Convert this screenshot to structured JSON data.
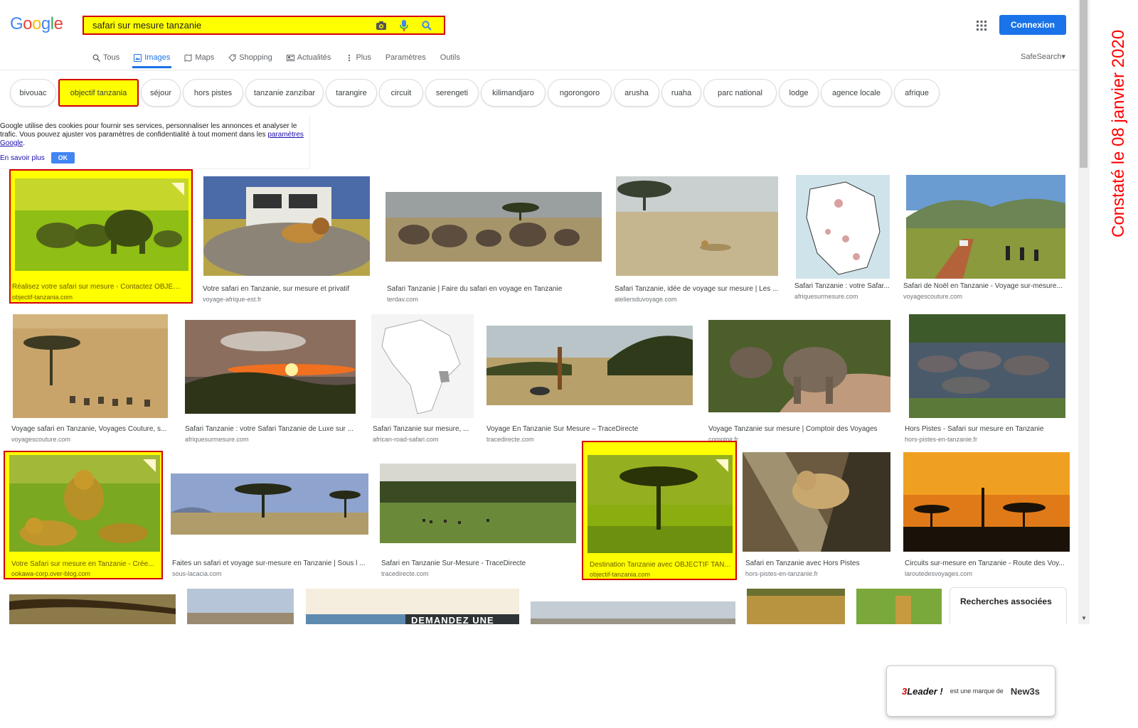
{
  "header": {
    "logo_text": "Google",
    "search_value": "safari sur mesure tanzanie",
    "signin_label": "Connexion",
    "safesearch_label": "SafeSearch▾"
  },
  "tabs": [
    {
      "label": "Tous",
      "icon": "search-icon"
    },
    {
      "label": "Images",
      "icon": "image-icon",
      "active": true
    },
    {
      "label": "Maps",
      "icon": "map-icon"
    },
    {
      "label": "Shopping",
      "icon": "tag-icon"
    },
    {
      "label": "Actualités",
      "icon": "news-icon"
    },
    {
      "label": "Plus",
      "icon": "more-vert-icon"
    },
    {
      "label": "Paramètres"
    },
    {
      "label": "Outils"
    }
  ],
  "chips": [
    "bivouac",
    "objectif tanzania",
    "séjour",
    "hors pistes",
    "tanzanie zanzibar",
    "tarangire",
    "circuit",
    "serengeti",
    "kilimandjaro",
    "ngorongoro",
    "arusha",
    "ruaha",
    "parc national",
    "lodge",
    "agence locale",
    "afrique"
  ],
  "cookie": {
    "text": "Google utilise des cookies pour fournir ses services, personnaliser les annonces et analyser le trafic. Vous pouvez ajuster vos paramètres de confidentialité à tout moment dans les",
    "link": "paramètres Google",
    "period": ".",
    "more": "En savoir plus",
    "ok": "OK"
  },
  "results": [
    {
      "caption": "Réalisez votre safari sur mesure - Contactez OBJEC...",
      "source": "objectif-tanzania.com"
    },
    {
      "caption": "Votre safari en Tanzanie, sur mesure et privatif",
      "source": "voyage-afrique-est.fr"
    },
    {
      "caption": "Safari Tanzanie | Faire du safari en voyage en Tanzanie",
      "source": "terdav.com"
    },
    {
      "caption": "Safari Tanzanie, idée de voyage sur mesure | Les ...",
      "source": "ateliersduvoyage.com"
    },
    {
      "caption": "Safari Tanzanie : votre Safar...",
      "source": "afriquesurmesure.com"
    },
    {
      "caption": "Safari de Noël en Tanzanie - Voyage sur-mesure...",
      "source": "voyagescouture.com"
    },
    {
      "caption": "Voyage safari en Tanzanie, Voyages Couture, s...",
      "source": "voyagescouture.com"
    },
    {
      "caption": "Safari Tanzanie : votre Safari Tanzanie de Luxe sur ...",
      "source": "afriquesurmesure.com"
    },
    {
      "caption": "Safari Tanzanie sur mesure, ...",
      "source": "african-road-safari.com"
    },
    {
      "caption": "Voyage En Tanzanie Sur Mesure – TraceDirecte",
      "source": "tracedirecte.com"
    },
    {
      "caption": "Voyage Tanzanie sur mesure | Comptoir des Voyages",
      "source": "comptoir.fr"
    },
    {
      "caption": "Hors Pistes - Safari sur mesure en Tanzanie",
      "source": "hors-pistes-en-tanzanie.fr"
    },
    {
      "caption": "Votre Safari sur mesure en Tanzanie - Crée...",
      "source": "ookawa-corp.over-blog.com"
    },
    {
      "caption": "Faites un safari et voyage sur-mesure en Tanzanie | Sous l ...",
      "source": "sous-lacacia.com"
    },
    {
      "caption": "Safari en Tanzanie Sur-Mesure - TraceDirecte",
      "source": "tracedirecte.com"
    },
    {
      "caption": "Destination Tanzanie avec OBJECTIF TAN...",
      "source": "objectif-tanzania.com"
    },
    {
      "caption": "Safari en Tanzanie avec Hors Pistes",
      "source": "hors-pistes-en-tanzanie.fr"
    },
    {
      "caption": "Circuits sur-mesure en Tanzanie - Route des Voy...",
      "source": "laroutedesvoyages.com"
    }
  ],
  "banner_text": "DEMANDEZ UNE",
  "related_title": "Recherches associées",
  "stamp_text": "Constaté le 08 janvier 2020",
  "brand": {
    "leader": "Leader !",
    "middle": "est une marque de",
    "company": "New3s"
  },
  "colors": {
    "highlight": "#ffff00",
    "highlight_border": "#d40000",
    "accent": "#1a73e8",
    "stamp": "#ff0000"
  }
}
